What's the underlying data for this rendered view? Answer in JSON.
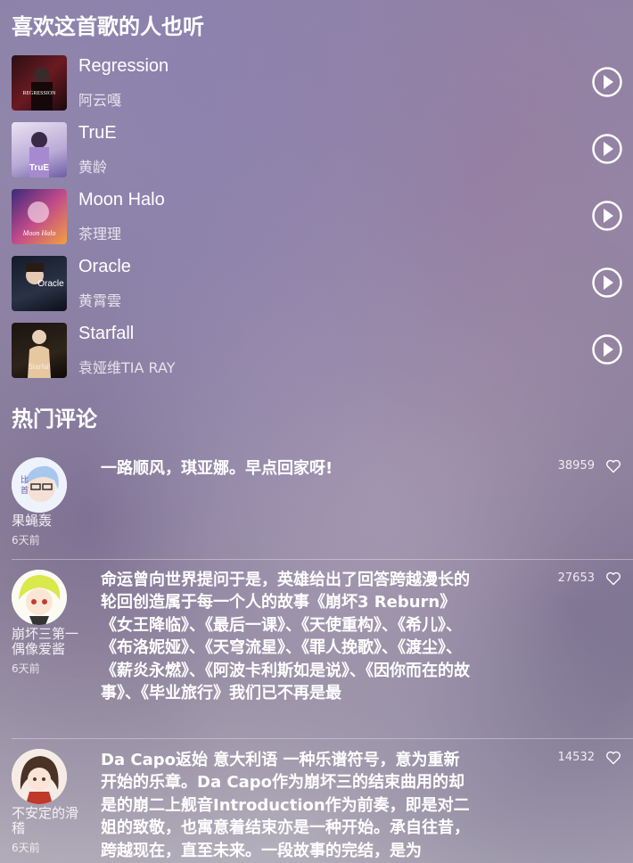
{
  "similar": {
    "title": "喜欢这首歌的人也听",
    "songs": [
      {
        "title": "Regression",
        "artist": "阿云嘎",
        "cover_text": "REGRESSION"
      },
      {
        "title": "TruE",
        "artist": "黄龄",
        "cover_text": "TruE"
      },
      {
        "title": "Moon Halo",
        "artist": "茶理理",
        "cover_text": "Moon Halo"
      },
      {
        "title": "Oracle",
        "artist": "黄霄雲",
        "cover_text": "Oracle"
      },
      {
        "title": "Starfall",
        "artist": "袁娅维TIA RAY",
        "cover_text": "Starfall"
      }
    ]
  },
  "comments": {
    "title": "热门评论",
    "items": [
      {
        "user": "果蝇轰",
        "time": "6天前",
        "likes": "38959",
        "text": "一路顺风，琪亚娜。早点回家呀!"
      },
      {
        "user": "崩坏三第一偶像爱酱",
        "time": "6天前",
        "likes": "27653",
        "text": "命运曾向世界提问于是，英雄给出了回答跨越漫长的轮回创造属于每一个人的故事《崩坏3 Reburn》《女王降临》、《最后一课》、《天使重构》、《希儿》、《布洛妮娅》、《天穹流星》、《罪人挽歌》、《渡尘》、《薪炎永燃》、《阿波卡利斯如是说》、《因你而在的故事》、《毕业旅行》我们已不再是最"
      },
      {
        "user": "不安定的滑稽",
        "time": "6天前",
        "likes": "14532",
        "text": "Da Capo返始 意大利语 一种乐谱符号，意为重新开始的乐章。Da Capo作为崩坏三的结束曲用的却是的崩二上舰音Introduction作为前奏，即是对二姐的致敬，也寓意着结束亦是一种开始。承自往昔，跨越现在，直至未来。一段故事的完结，是为"
      }
    ]
  }
}
